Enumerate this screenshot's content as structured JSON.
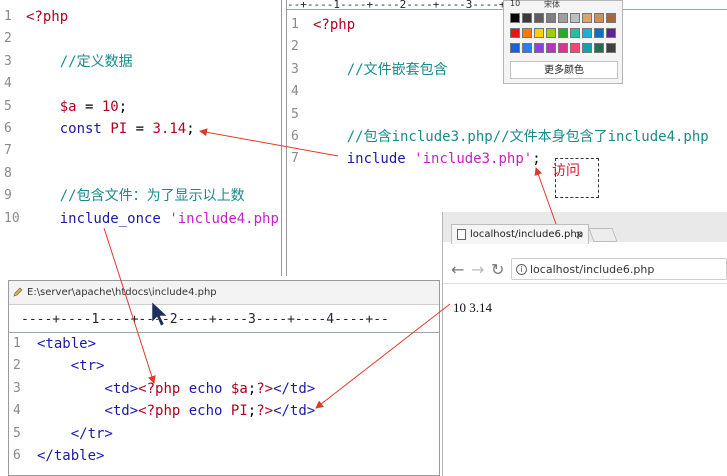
{
  "left_editor": {
    "lines": [
      {
        "n": "1",
        "text": "<?php"
      },
      {
        "n": "2",
        "text": ""
      },
      {
        "n": "3",
        "text": "    //定义数据"
      },
      {
        "n": "4",
        "text": ""
      },
      {
        "n": "5",
        "text": "    $a = 10;"
      },
      {
        "n": "6",
        "text": "    const PI = 3.14;"
      },
      {
        "n": "7",
        "text": ""
      },
      {
        "n": "8",
        "text": ""
      },
      {
        "n": "9",
        "text": "    //包含文件：为了显示以上数"
      },
      {
        "n": "10",
        "text": "    include_once 'include4.php"
      }
    ]
  },
  "right_editor": {
    "ruler": "--+----1----+----2----+----3----+----4----+--",
    "lines": [
      {
        "n": "1",
        "text": "<?php"
      },
      {
        "n": "2",
        "text": ""
      },
      {
        "n": "3",
        "text": "    //文件嵌套包含"
      },
      {
        "n": "4",
        "text": ""
      },
      {
        "n": "5",
        "text": ""
      },
      {
        "n": "6",
        "text": "    //包含include3.php//文件本身包含了include4.php"
      },
      {
        "n": "7",
        "text": "    include 'include3.php';"
      }
    ]
  },
  "bottom_editor": {
    "title": "E:\\server\\apache\\htdocs\\include4.php",
    "ruler": "----+----1----+----2----+----3----+----4----+--",
    "lines": [
      {
        "n": "1",
        "text": "<table>"
      },
      {
        "n": "2",
        "text": "    <tr>"
      },
      {
        "n": "3",
        "text": "        <td><?php echo $a;?></td>"
      },
      {
        "n": "4",
        "text": "        <td><?php echo PI;?></td>"
      },
      {
        "n": "5",
        "text": "    </tr>"
      },
      {
        "n": "6",
        "text": "</table>"
      }
    ]
  },
  "palette": {
    "size_value": "10",
    "font_value": "宋体",
    "more_label": "更多颜色",
    "rows": [
      [
        "#000000",
        "#3a3a3a",
        "#5e5e5e",
        "#7f7f7f",
        "#9f9f9f",
        "#bfbfbf",
        "#d9a56a",
        "#c9915a",
        "#a26a3c"
      ],
      [
        "#e01818",
        "#ff7a00",
        "#ffd000",
        "#9dd000",
        "#20b020",
        "#20c0a0",
        "#18b0e0",
        "#1070c0",
        "#6020a0"
      ],
      [
        "#1860e0",
        "#2080ff",
        "#9040e0",
        "#c030c0",
        "#e03090",
        "#ff4070",
        "#10a0b0",
        "#207050",
        "#404040"
      ]
    ]
  },
  "browser": {
    "tab_title": "localhost/include6.php",
    "tab_close": "×",
    "url": "localhost/include6.php",
    "output": "10 3.14"
  },
  "annotation": {
    "visit_label": "访问"
  },
  "colors": {
    "arrow": "#e03a2a",
    "keyword": "#1a1aa6",
    "string": "#c820c8",
    "comment": "#1a8a8a",
    "number": "#b00020"
  }
}
